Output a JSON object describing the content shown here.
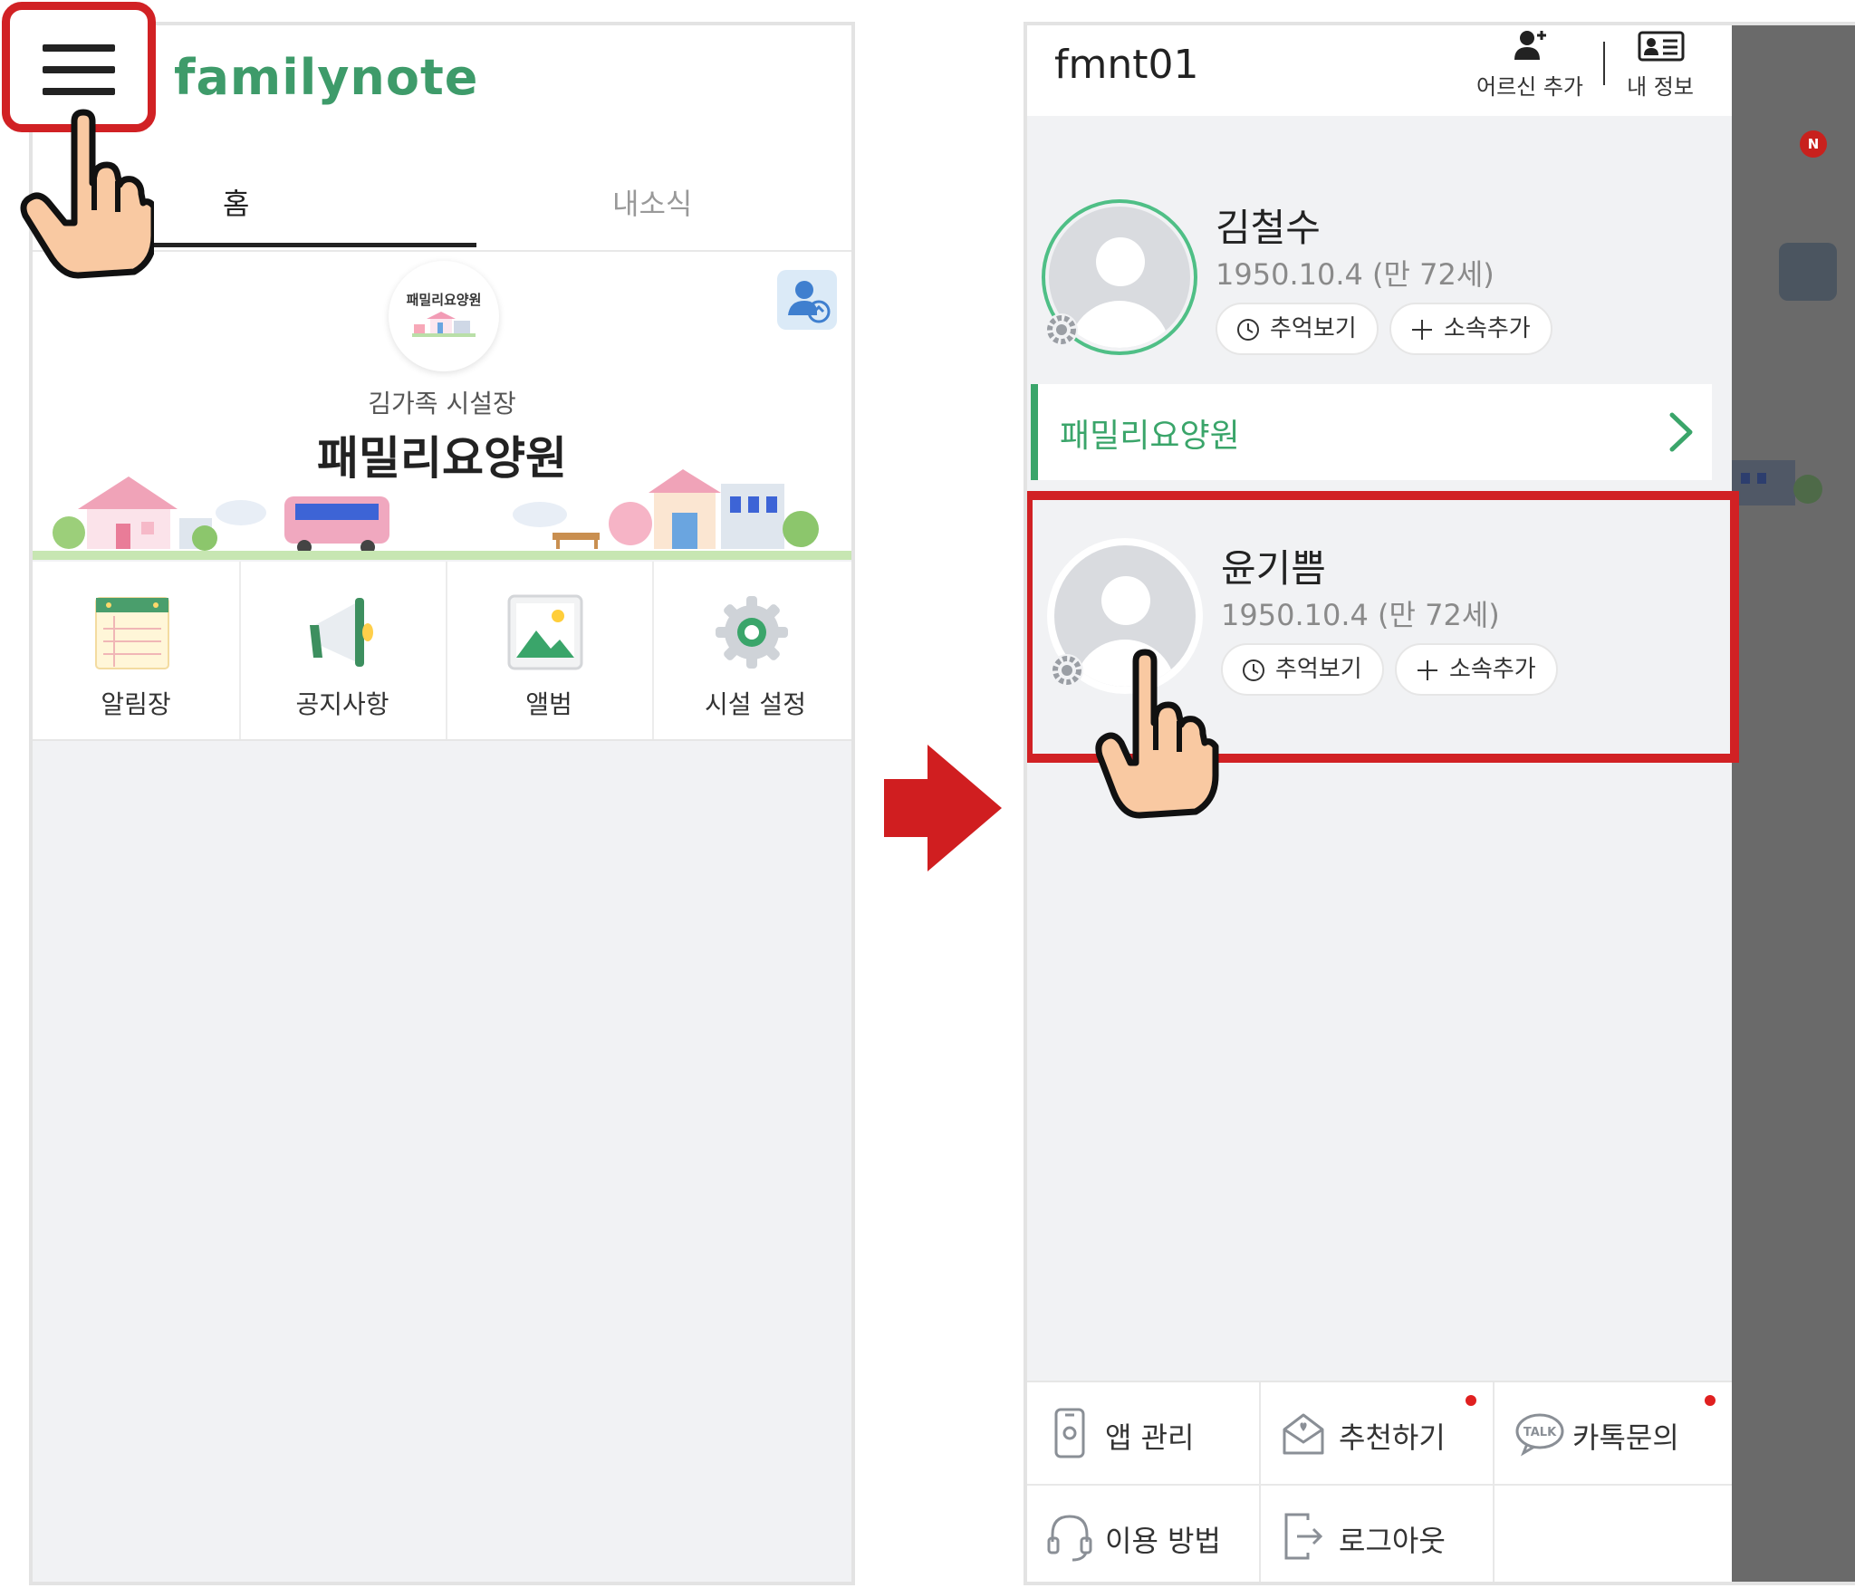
{
  "left_screen": {
    "logo": "familynote",
    "tabs": [
      "홈",
      "내소식"
    ],
    "facility_logo_text": "패밀리요양원",
    "director": "김가족 시설장",
    "facility_name": "패밀리요양원",
    "menu": [
      {
        "label": "알림장",
        "icon": "notebook-icon"
      },
      {
        "label": "공지사항",
        "icon": "megaphone-icon"
      },
      {
        "label": "앨범",
        "icon": "album-icon"
      },
      {
        "label": "시설 설정",
        "icon": "settings-gear-icon"
      }
    ]
  },
  "right_screen": {
    "user_id": "fmnt01",
    "header_actions": {
      "add_elder": "어르신 추가",
      "my_info": "내 정보"
    },
    "elders": [
      {
        "name": "김철수",
        "birth": "1950.10.4 (만 72세)",
        "memories": "추억보기",
        "add_affiliation": "소속추가",
        "selected_ring": true
      },
      {
        "name": "윤기쁨",
        "birth": "1950.10.4 (만 72세)",
        "memories": "추억보기",
        "add_affiliation": "소속추가",
        "selected_ring": false
      }
    ],
    "facility_row": "패밀리요양원",
    "bottom_menu": [
      {
        "label": "앱 관리",
        "icon": "phone-settings-icon",
        "dot": false
      },
      {
        "label": "추천하기",
        "icon": "recommend-mail-icon",
        "dot": true
      },
      {
        "label": "카톡문의",
        "icon": "talk-bubble-icon",
        "dot": true
      },
      {
        "label": "이용 방법",
        "icon": "headset-icon",
        "dot": false
      },
      {
        "label": "로그아웃",
        "icon": "logout-icon",
        "dot": false
      }
    ],
    "notification_badge": "N"
  },
  "colors": {
    "highlight": "#d12124",
    "brand_green": "#3e9b6a",
    "facility_green": "#3aa56a",
    "background": "#f1f2f4"
  }
}
